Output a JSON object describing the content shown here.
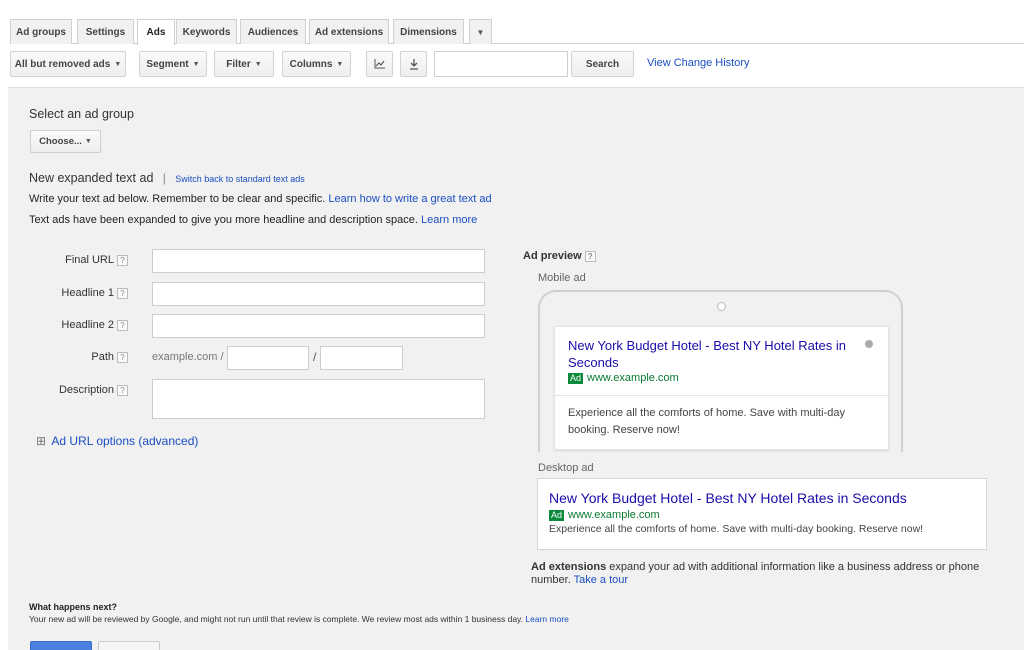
{
  "tabs": [
    "Ad groups",
    "Settings",
    "Ads",
    "Keywords",
    "Audiences",
    "Ad extensions",
    "Dimensions"
  ],
  "tab_more": "▼",
  "toolbar": {
    "filter_status": "All but removed ads",
    "segment": "Segment",
    "filter": "Filter",
    "columns": "Columns",
    "search_button": "Search",
    "search_value": "",
    "view_change_history": "View Change History"
  },
  "form": {
    "select_group_label": "Select an ad group",
    "choose_button": "Choose...",
    "new_ad_title": "New expanded text ad",
    "separator": "|",
    "switch_link": "Switch back to standard text ads",
    "intro_text": "Write your text ad below. Remember to be clear and specific.",
    "intro_link": "Learn how to write a great text ad",
    "expanded_text": "Text ads have been expanded to give you more headline and description space.",
    "expanded_link": "Learn more",
    "final_url_label": "Final URL",
    "headline1_label": "Headline 1",
    "headline2_label": "Headline 2",
    "path_label": "Path",
    "path_prefix": "example.com /",
    "path_sep": "/",
    "description_label": "Description",
    "help_icon": "?",
    "url_options_toggle": "⊞",
    "url_options": "Ad URL options (advanced)"
  },
  "preview": {
    "title": "Ad preview",
    "mobile_label": "Mobile ad",
    "desktop_label": "Desktop ad",
    "headline_mobile": "New York Budget Hotel - Best NY Hotel Rates in Seconds",
    "headline_desktop_1": "New York Budget Hotel",
    "headline_desktop_sep": " - ",
    "headline_desktop_2": "Best NY Hotel Rates in Seconds",
    "ad_badge": "Ad",
    "display_url": "www.example.com",
    "description_mobile": "Experience all the comforts of home. Save with multi-day booking. Reserve now!",
    "description_desktop": "Experience all the comforts of home. Save with multi-day booking. Reserve now!",
    "extensions_bold": "Ad extensions",
    "extensions_text": " expand your ad with additional information like a business address or phone number.",
    "extensions_link": "Take a tour"
  },
  "footer": {
    "what_next_title": "What happens next?",
    "what_next_text": "Your new ad will be reviewed by Google, and might not run until that review is complete. We review most ads within 1 business day.",
    "what_next_link": "Learn more"
  },
  "colors": {
    "link": "#1a4ec2",
    "ad_green": "#0a8a3a",
    "panel_bg": "#f1f1f1",
    "save_blue": "#4d7fe0"
  }
}
